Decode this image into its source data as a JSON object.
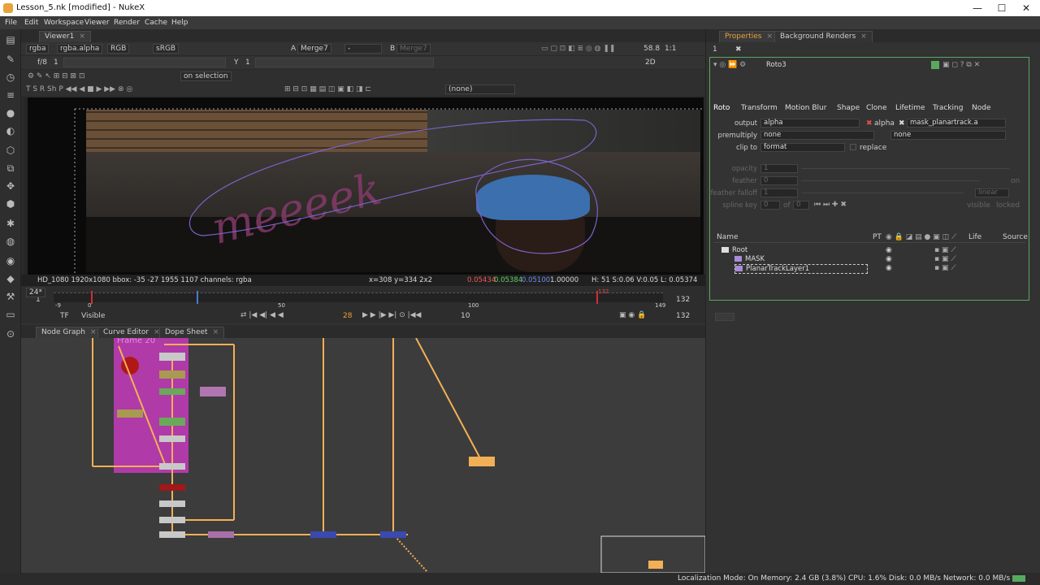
{
  "window": {
    "title": "Lesson_5.nk [modified] - NukeX",
    "controls": [
      "—",
      "☐",
      "✕"
    ]
  },
  "menu": [
    "File",
    "Edit",
    "Workspace",
    "Viewer",
    "Render",
    "Cache",
    "Help"
  ],
  "viewer": {
    "tab_label": "Viewer1",
    "channels": "rgba",
    "alpha_channel": "rgba.alpha",
    "rgb": "RGB",
    "colorspace": "sRGB",
    "a_label": "A",
    "a_input": "Merge7",
    "a_op": "-",
    "b_label": "B",
    "b_input": "Merge7",
    "fstop": "f/8",
    "gain_val": "1",
    "y_label": "Y",
    "gamma_val": "1",
    "zoom": "58.8",
    "ratio": "1:1",
    "mode": "2D",
    "update": "on selection",
    "none_menu": "(none)",
    "graffiti_text": "meeeek",
    "status_format": "HD_1080 1920x1080  bbox: -35 -27 1955 1107 channels: rgba",
    "status_coords": "x=308 y=334 2x2",
    "status_r": "0.05434",
    "status_g": "0.05384",
    "status_b": "0.05100",
    "status_a": "1.00000",
    "status_hsv": "H: 51 S:0.06 V:0.05  L: 0.05374"
  },
  "timeline": {
    "start": "1",
    "end": "132",
    "tick_labels": [
      "-9",
      "0",
      "50",
      "100",
      "149"
    ],
    "fps": "24*",
    "tf": "TF",
    "visible": "Visible",
    "current_frame": "28",
    "step": "10",
    "end_frame": "132",
    "in_marker": "132"
  },
  "node_graph": {
    "tabs": [
      "Node Graph",
      "Curve Editor",
      "Dope Sheet"
    ],
    "backdrop_label": "Frame 20"
  },
  "properties": {
    "tabs": [
      "Properties",
      "Background Renders"
    ],
    "node_name": "Roto3",
    "node_tabs": [
      "Roto",
      "Transform",
      "Motion Blur",
      "Shape",
      "Clone",
      "Lifetime",
      "Tracking",
      "Node"
    ],
    "output_label": "output",
    "output_value": "alpha",
    "alpha_check": "alpha",
    "mask_value": "mask_planartrack.a",
    "premult_label": "premultiply",
    "premult_value": "none",
    "premult_value2": "none",
    "clip_label": "clip to",
    "clip_value": "format",
    "replace_label": "replace",
    "opacity_label": "opacity",
    "opacity_value": "1",
    "feather_label": "feather",
    "feather_value": "0",
    "on_label": "on",
    "falloff_label": "feather falloff",
    "falloff_value": "1",
    "falloff_mode": "linear",
    "splinekey_label": "spline key",
    "splinekey_value": "0",
    "of_label": "of",
    "of_value": "0",
    "visible_label": "visible",
    "locked_label": "locked",
    "tree_headers": [
      "Name",
      "PT",
      "Life",
      "Source"
    ],
    "tree_items": [
      "Root",
      "MASK",
      "PlanarTrackLayer1"
    ]
  },
  "status_bar": "Localization Mode: On Memory: 2.4 GB (3.8%) CPU: 1.6% Disk: 0.0 MB/s Network: 0.0 MB/s",
  "colors": {
    "accent_orange": "#e8a23c",
    "roto_stroke": "#7a62c9",
    "backdrop_magenta": "#b03aa8",
    "properties_border": "#59a85f"
  }
}
